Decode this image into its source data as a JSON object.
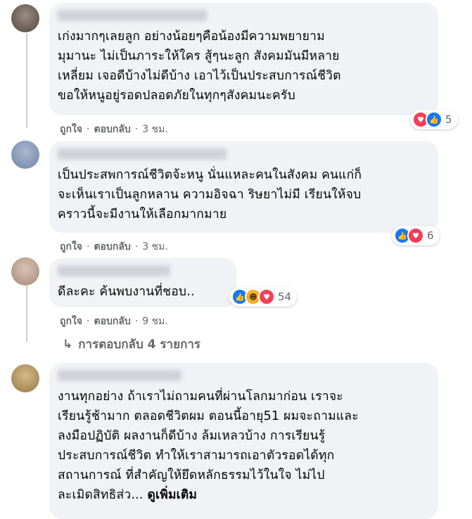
{
  "comments": [
    {
      "text": "เก่งมากๆเลยลูก อย่างน้อยๆคือน้องมีความพยายาม\nมุมานะ ไม่เป็นภาระให้ใคร สู้ๆนะลูก สังคมมันมีหลาย\nเหลี่ยม เจอดีบ้างไม่ดีบ้าง เอาไว้เป็นประสบการณ์ชีวิต\nขอให้หนูอยู่รอดปลอดภัยในทุกๆสังคมนะครับ",
      "reaction_count": "5",
      "reactions": [
        "love-icon",
        "like-icon"
      ],
      "like_label": "ถูกใจ",
      "reply_label": "ตอบกลับ",
      "time": "3 ชม."
    },
    {
      "text": "เป็นประสพการณ์ชีวิตจ้ะหนู นั่นแหละคนในสังคม คนแก่ก็\nจะเห็นเราเป็นลูกหลาน ความอิจฉา ริษยาไม่มี เรียนให้จบ\nคราวนี้จะมีงานให้เลือกมากมาย",
      "reaction_count": "6",
      "reactions": [
        "like-icon",
        "love-icon"
      ],
      "like_label": "ถูกใจ",
      "reply_label": "ตอบกลับ",
      "time": "3 ชม."
    },
    {
      "text": "ดีละคะ ค้นพบงานที่ชอบ..",
      "reaction_count": "54",
      "reactions": [
        "like-icon",
        "haha-icon",
        "love-icon"
      ],
      "like_label": "ถูกใจ",
      "reply_label": "ตอบกลับ",
      "time": "9 ชม."
    },
    {
      "text": "งานทุกอย่าง ถ้าเราไม่ถามคนที่ผ่านโลกมาก่อน เราจะ\nเรียนรู้ช้ามาก ตลอดชีวิตผม ตอนนี้อายุ51 ผมจะถามและ\nลงมือปฏิบัติ ผลงานก็ดีบ้าง ล้มเหลวบ้าง การเรียนรู้\nประสบการณ์ชีวิต ทำให้เราสามารถเอาตัวรอดได้ทุก\nสถานการณ์ ที่สำคัญให้ยึดหลักธรรมไว้ในใจ ไม่ไป\nละเมิดสิทธิส่ว...",
      "see_more": "ดูเพิ่มเติม"
    }
  ],
  "replies_link": "การตอบกลับ 4 รายการ",
  "colors": {
    "like": "#1877f2",
    "love": "#f33e58",
    "haha": "#f7b125",
    "bubble": "#f0f2f5",
    "meta": "#65676b"
  }
}
